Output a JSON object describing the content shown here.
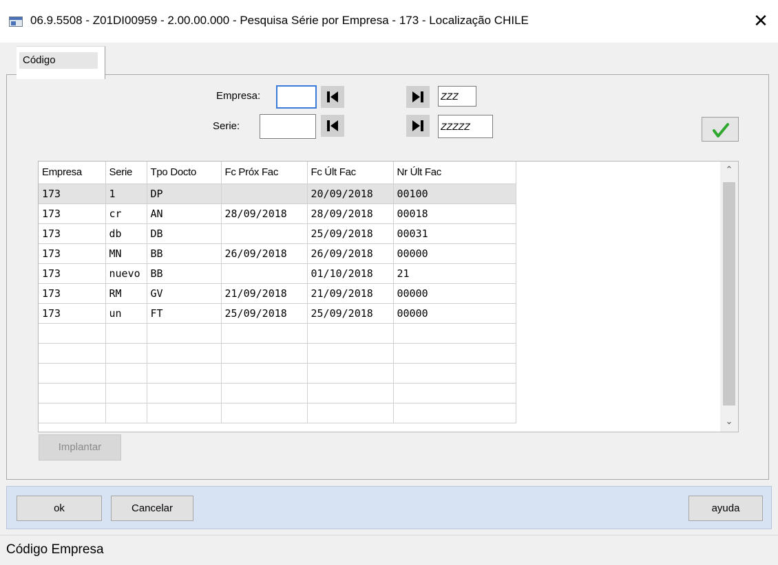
{
  "window": {
    "title": "06.9.5508 - Z01DI00959 - 2.00.00.000 - Pesquisa Série por Empresa - 173 - Localização CHILE",
    "close_glyph": "✕"
  },
  "tabs": [
    {
      "label": "Código"
    }
  ],
  "filters": {
    "empresa_label": "Empresa:",
    "empresa_from": "",
    "empresa_to": "ZZZ",
    "serie_label": "Serie:",
    "serie_from": "",
    "serie_to": "ZZZZZ"
  },
  "grid": {
    "columns": [
      "Empresa",
      "Serie",
      "Tpo Docto",
      "Fc Próx Fac",
      "Fc Últ Fac",
      "Nr Últ Fac"
    ],
    "rows": [
      [
        "173",
        "1",
        "DP",
        "",
        "20/09/2018",
        "00100"
      ],
      [
        "173",
        "cr",
        "AN",
        "28/09/2018",
        "28/09/2018",
        "00018"
      ],
      [
        "173",
        "db",
        "DB",
        "",
        "25/09/2018",
        "00031"
      ],
      [
        "173",
        "MN",
        "BB",
        "26/09/2018",
        "26/09/2018",
        "00000"
      ],
      [
        "173",
        "nuevo",
        "BB",
        "",
        "01/10/2018",
        "21"
      ],
      [
        "173",
        "RM",
        "GV",
        "21/09/2018",
        "21/09/2018",
        "00000"
      ],
      [
        "173",
        "un",
        "FT",
        "25/09/2018",
        "25/09/2018",
        "00000"
      ]
    ],
    "selected_row": 0
  },
  "buttons": {
    "implantar": "Implantar",
    "ok": "ok",
    "cancelar": "Cancelar",
    "ayuda": "ayuda"
  },
  "status": {
    "text": "Código Empresa"
  },
  "colors": {
    "accent": "#3a7ad8",
    "confirm_check": "#2fa82f",
    "bottom_bar": "#d7e2f2"
  }
}
